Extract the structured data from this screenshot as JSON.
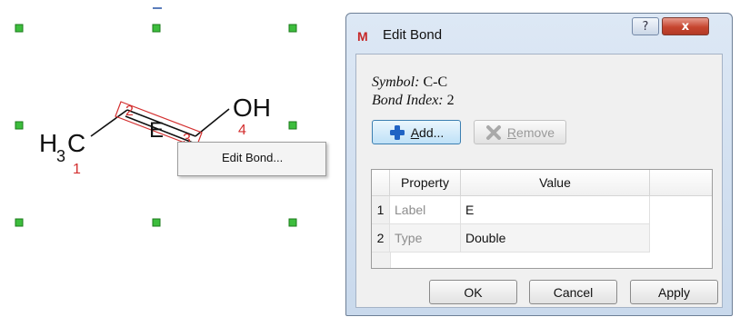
{
  "canvas": {
    "atoms": {
      "c1": {
        "main": "H",
        "sub": "3",
        "tail": "C",
        "index": "1"
      },
      "bond_label": "E",
      "oh": "OH",
      "oh_index": "4"
    },
    "bond_index_labels": [
      "2",
      "3"
    ],
    "context_menu": {
      "item": "Edit Bond..."
    },
    "colors": {
      "handle": "#3dbd3d",
      "index": "#d32f2f",
      "bond_box": "#d32f2f"
    }
  },
  "dialog": {
    "title": "Edit Bond",
    "help_glyph": "?",
    "close_glyph": "x",
    "symbol_key": "Symbol:",
    "symbol_value": "C-C",
    "bond_index_key": "Bond Index:",
    "bond_index_value": "2",
    "add_button": {
      "label": "dd...",
      "underline": "A"
    },
    "remove_button": {
      "label": "emove",
      "underline": "R"
    },
    "table": {
      "columns": [
        "Property",
        "Value"
      ],
      "rows": [
        {
          "num": "1",
          "property": "Label",
          "value": "E"
        },
        {
          "num": "2",
          "property": "Type",
          "value": "Double"
        }
      ]
    },
    "ok_label": "OK",
    "cancel_label": "Cancel",
    "apply_label": "Apply"
  }
}
